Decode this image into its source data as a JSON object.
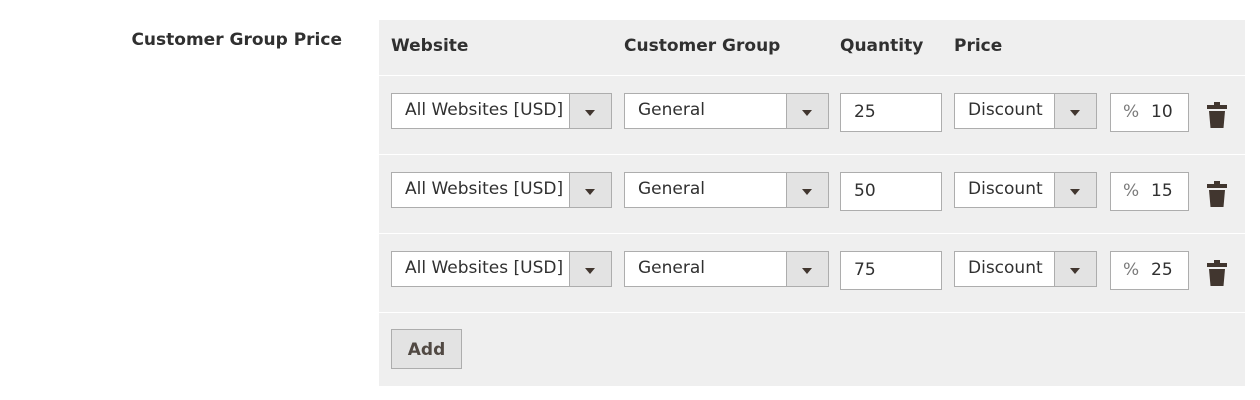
{
  "field": {
    "label": "Customer Group Price"
  },
  "table": {
    "headers": {
      "website": "Website",
      "customer_group": "Customer Group",
      "quantity": "Quantity",
      "price": "Price"
    },
    "rows": [
      {
        "website": "All Websites [USD]",
        "customer_group": "General",
        "quantity": "25",
        "price_type": "Discount",
        "percent_symbol": "%",
        "value": "10"
      },
      {
        "website": "All Websites [USD]",
        "customer_group": "General",
        "quantity": "50",
        "price_type": "Discount",
        "percent_symbol": "%",
        "value": "15"
      },
      {
        "website": "All Websites [USD]",
        "customer_group": "General",
        "quantity": "75",
        "price_type": "Discount",
        "percent_symbol": "%",
        "value": "25"
      }
    ]
  },
  "actions": {
    "add_label": "Add"
  },
  "icons": {
    "delete": "trash-icon",
    "dropdown": "chevron-down-icon"
  },
  "colors": {
    "panel_bg": "#efefef",
    "select_button_bg": "#e3e3e3",
    "border": "#adadad",
    "icon": "#41362f",
    "text": "#303030"
  }
}
